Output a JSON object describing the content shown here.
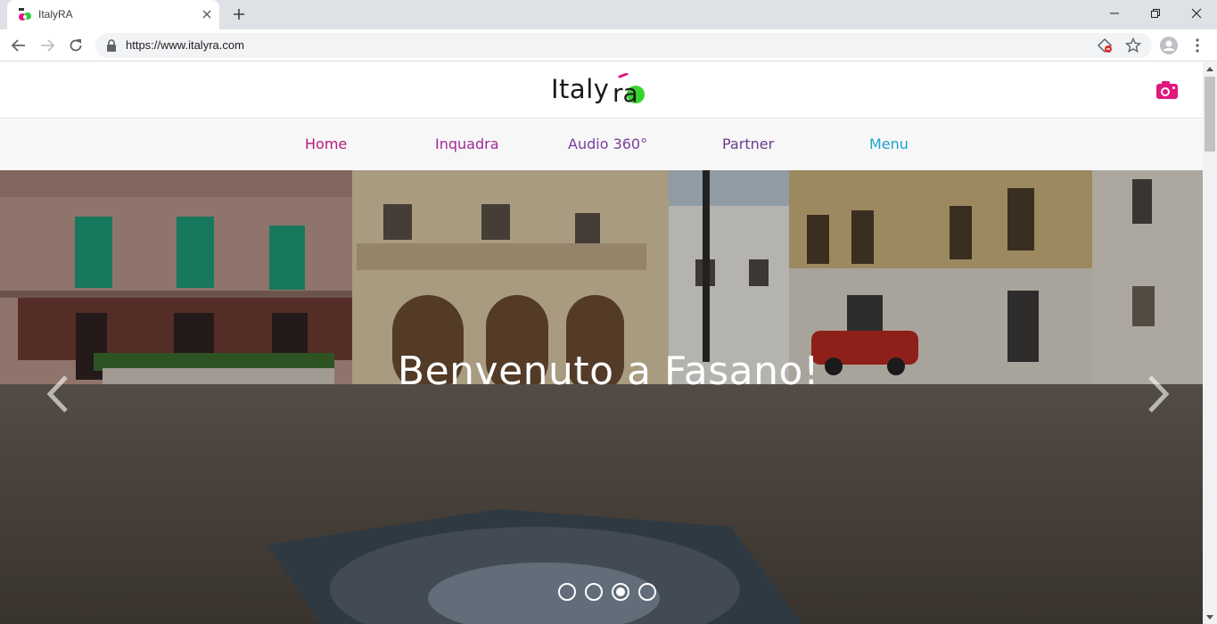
{
  "browser": {
    "tab_title": "ItalyRA",
    "url": "https://www.italyra.com"
  },
  "site": {
    "logo_text": "Italy",
    "logo_mark_text": "ra",
    "nav": [
      {
        "label": "Home",
        "color": "#b5197a"
      },
      {
        "label": "Inquadra",
        "color": "#a02a9a"
      },
      {
        "label": "Audio 360°",
        "color": "#7a3f9e"
      },
      {
        "label": "Partner",
        "color": "#6a3b8c"
      },
      {
        "label": "Menu",
        "color": "#1aa3cf"
      }
    ],
    "accent_color": "#e0187e",
    "hero": {
      "title": "Benvenuto a Fasano!",
      "slide_count": 4,
      "active_slide": 3
    }
  },
  "icons": {
    "camera": "camera-icon",
    "prev": "chevron-left-icon",
    "next": "chevron-right-icon"
  }
}
